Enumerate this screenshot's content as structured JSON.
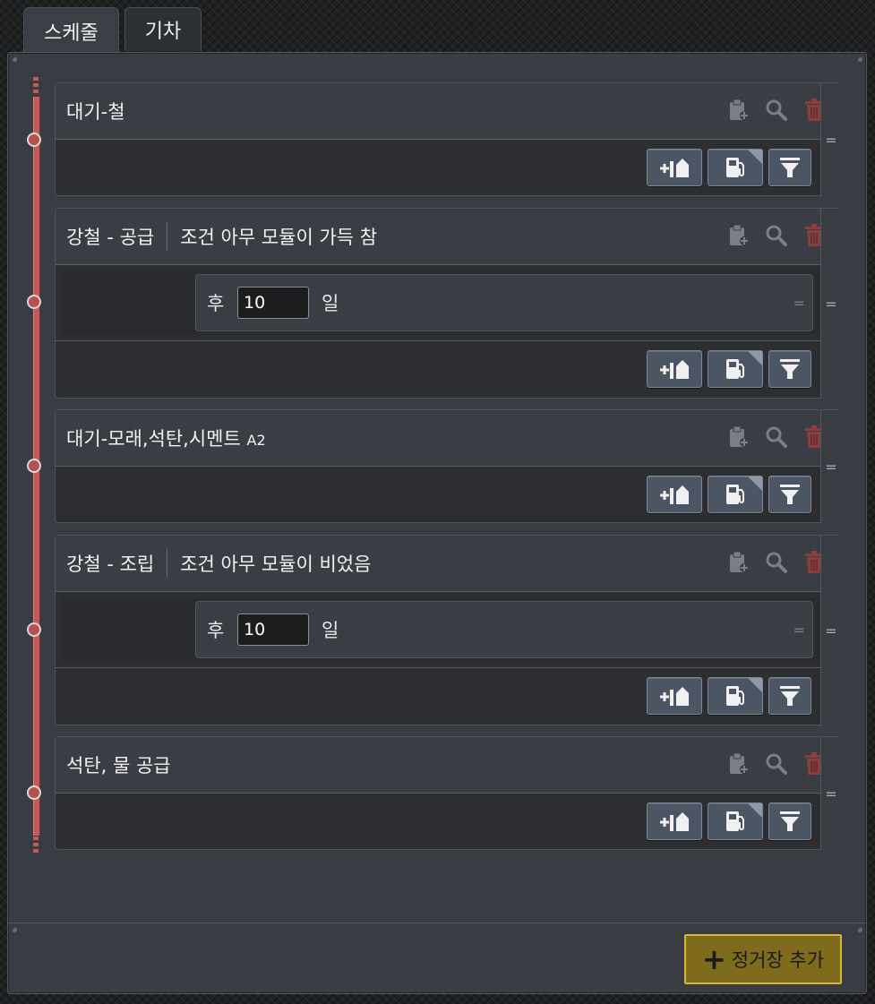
{
  "tabs": [
    {
      "label": "스케줄",
      "active": true
    },
    {
      "label": "기차",
      "active": false
    }
  ],
  "stops": [
    {
      "title": "대기-철",
      "condition": "",
      "wait": null
    },
    {
      "title": "강철 - 공급",
      "condition": "조건 아무 모듈이 가득 참",
      "wait": {
        "after": "후",
        "value": "10",
        "unit": "일"
      }
    },
    {
      "title": "대기-모래,석탄,시멘트",
      "title_suffix": "A2",
      "condition": "",
      "wait": null
    },
    {
      "title": "강철 - 조립",
      "condition": "조건 아무 모듈이 비었음",
      "wait": {
        "after": "후",
        "value": "10",
        "unit": "일"
      }
    },
    {
      "title": "석탄, 물 공급",
      "condition": "",
      "wait": null
    }
  ],
  "icons": {
    "clipboard": "clipboard-add-icon",
    "search": "search-icon",
    "delete": "trash-icon",
    "load": "add-cargo-icon",
    "refuel": "fuel-pump-icon",
    "filter": "filter-icon"
  },
  "colors": {
    "timeline": "#c25a5a",
    "button": "#4c5563",
    "add_button": "#7e6b1c",
    "add_border": "#d7b632"
  },
  "add_stop_label": "정거장 추가"
}
